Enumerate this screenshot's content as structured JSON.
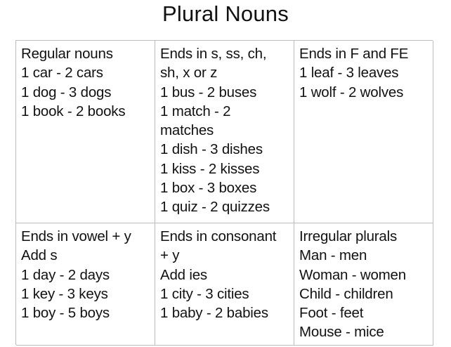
{
  "title": "Plural Nouns",
  "cells": [
    {
      "lines": [
        "Regular nouns",
        "1 car -  2 cars",
        "1 dog - 3 dogs",
        "1 book - 2 books"
      ]
    },
    {
      "lines": [
        "Ends in s, ss, ch,",
        "sh, x or z",
        "1 bus - 2 buses",
        "1 match - 2",
        "matches",
        "1 dish - 3 dishes",
        "1 kiss - 2 kisses",
        "1 box - 3 boxes",
        "1 quiz - 2 quizzes"
      ]
    },
    {
      "lines": [
        "Ends in F and FE",
        "1 leaf - 3 leaves",
        "1 wolf - 2 wolves"
      ]
    },
    {
      "lines": [
        "Ends in vowel + y",
        "Add s",
        "1 day - 2 days",
        "1 key - 3 keys",
        "1 boy - 5 boys"
      ]
    },
    {
      "lines": [
        "Ends in consonant",
        "+ y",
        "Add ies",
        "1 city - 3 cities",
        "1 baby - 2 babies"
      ]
    },
    {
      "lines": [
        "Irregular plurals",
        "Man - men",
        "Woman - women",
        "Child - children",
        "Foot - feet",
        "Mouse - mice"
      ]
    }
  ]
}
